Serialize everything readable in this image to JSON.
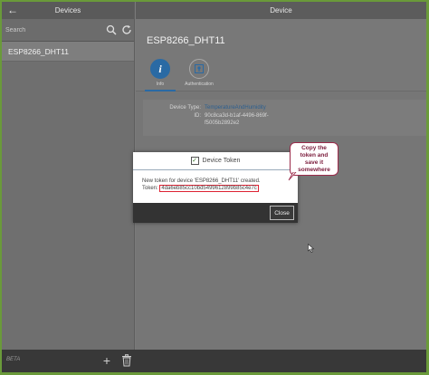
{
  "left_pane": {
    "title": "Devices",
    "search_placeholder": "Search",
    "devices": [
      "ESP8266_DHT11"
    ]
  },
  "right_pane": {
    "title": "Device",
    "device_name": "ESP8266_DHT11",
    "tabs": [
      {
        "label": "Info",
        "icon": "info-icon",
        "selected": true
      },
      {
        "label": "Authentication",
        "icon": "authentication-icon",
        "selected": false
      }
    ],
    "info": {
      "type_label": "Device Type:",
      "type_value": "TemperatureAndHumidity",
      "id_label": "ID:",
      "id_line1": "90c8ca3d-b1af-4496-869f-",
      "id_line2": "f5005b2892e2"
    }
  },
  "footer": {
    "beta_label": "BETA"
  },
  "dialog": {
    "title": "Device Token",
    "line1": "New token for device 'ESP8266_DHT11' created.",
    "token_label": "Token:",
    "token_value": "4da6eb85cc10bd5499612899b85c4e7c",
    "close_label": "Close"
  },
  "callout": {
    "line1": "Copy the",
    "line2": "token and",
    "line3": "save it",
    "line4": "somewhere"
  },
  "colors": {
    "accent": "#2a6aa4",
    "highlight_border": "#d22233",
    "callout_border": "#9b2a4a"
  }
}
